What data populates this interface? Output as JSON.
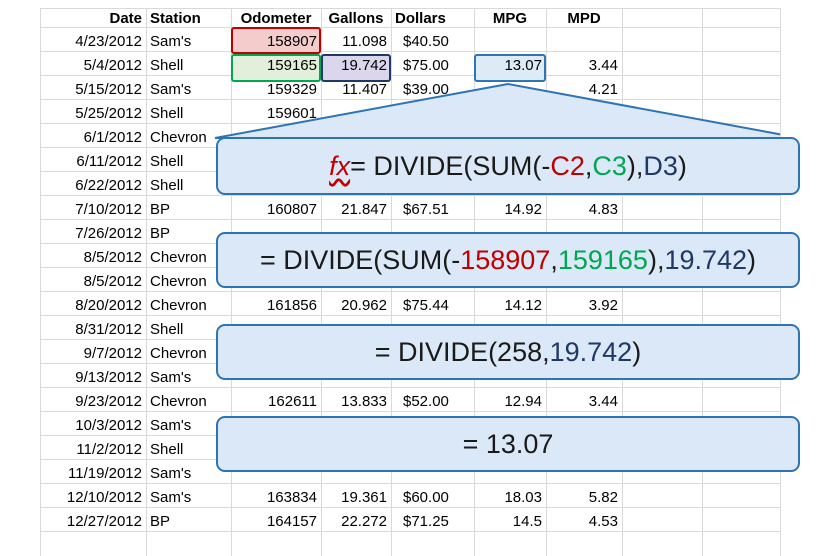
{
  "headers": [
    "Date",
    "Station",
    "Odometer",
    "Gallons",
    "Dollars",
    "MPG",
    "MPD"
  ],
  "rows": [
    [
      "4/23/2012",
      "Sam's",
      "158907",
      "11.098",
      "$40.50",
      "",
      ""
    ],
    [
      "5/4/2012",
      "Shell",
      "159165",
      "19.742",
      "$75.00",
      "13.07",
      "3.44"
    ],
    [
      "5/15/2012",
      "Sam's",
      "159329",
      "11.407",
      "$39.00",
      "",
      "4.21"
    ],
    [
      "5/25/2012",
      "Shell",
      "159601",
      "",
      "",
      "",
      ""
    ],
    [
      "6/1/2012",
      "Chevron",
      "",
      "",
      "",
      "",
      ""
    ],
    [
      "6/11/2012",
      "Shell",
      "",
      "",
      "",
      "",
      ""
    ],
    [
      "6/22/2012",
      "Shell",
      "",
      "",
      "",
      "",
      ""
    ],
    [
      "7/10/2012",
      "BP",
      "160807",
      "21.847",
      "$67.51",
      "14.92",
      "4.83"
    ],
    [
      "7/26/2012",
      "BP",
      "",
      "",
      "",
      "",
      ""
    ],
    [
      "8/5/2012",
      "Chevron",
      "",
      "",
      "",
      "",
      ""
    ],
    [
      "8/5/2012",
      "Chevron",
      "",
      "",
      "",
      "",
      ""
    ],
    [
      "8/20/2012",
      "Chevron",
      "161856",
      "20.962",
      "$75.44",
      "14.12",
      "3.92"
    ],
    [
      "8/31/2012",
      "Shell",
      "",
      "",
      "",
      "",
      ""
    ],
    [
      "9/7/2012",
      "Chevron",
      "",
      "",
      "",
      "",
      ""
    ],
    [
      "9/13/2012",
      "Sam's",
      "",
      "",
      "",
      "",
      ""
    ],
    [
      "9/23/2012",
      "Chevron",
      "162611",
      "13.833",
      "$52.00",
      "12.94",
      "3.44"
    ],
    [
      "10/3/2012",
      "Sam's",
      "",
      "",
      "",
      "",
      ""
    ],
    [
      "11/2/2012",
      "Shell",
      "",
      "",
      "",
      "",
      ""
    ],
    [
      "11/19/2012",
      "Sam's",
      "",
      "",
      "",
      "",
      ""
    ],
    [
      "12/10/2012",
      "Sam's",
      "163834",
      "19.361",
      "$60.00",
      "18.03",
      "5.82"
    ],
    [
      "12/27/2012",
      "BP",
      "164157",
      "22.272",
      "$71.25",
      "14.5",
      "4.53"
    ]
  ],
  "callouts": {
    "line1": {
      "fx": "fx",
      "p1": " = DIVIDE(SUM(-",
      "c2": "C2",
      ",": ", ",
      "c3": "C3",
      "p2": "),",
      "d3": "D3",
      "p3": ")"
    },
    "line2": {
      "p1": "= DIVIDE(SUM(-",
      "a": "158907",
      ",": ", ",
      "b": "159165",
      "p2": "),",
      "c": "19.742",
      "p3": ")"
    },
    "line3": {
      "p1": "= DIVIDE(258,",
      "c": "19.742",
      "p3": ")"
    },
    "line4": {
      "text": "= 13.07"
    }
  },
  "colors": {
    "ref_c2": "#c00000",
    "ref_c3": "#00a651",
    "ref_d3": "#1f3864",
    "callout_border": "#2e74b5",
    "callout_fill": "#dbe8f7"
  }
}
